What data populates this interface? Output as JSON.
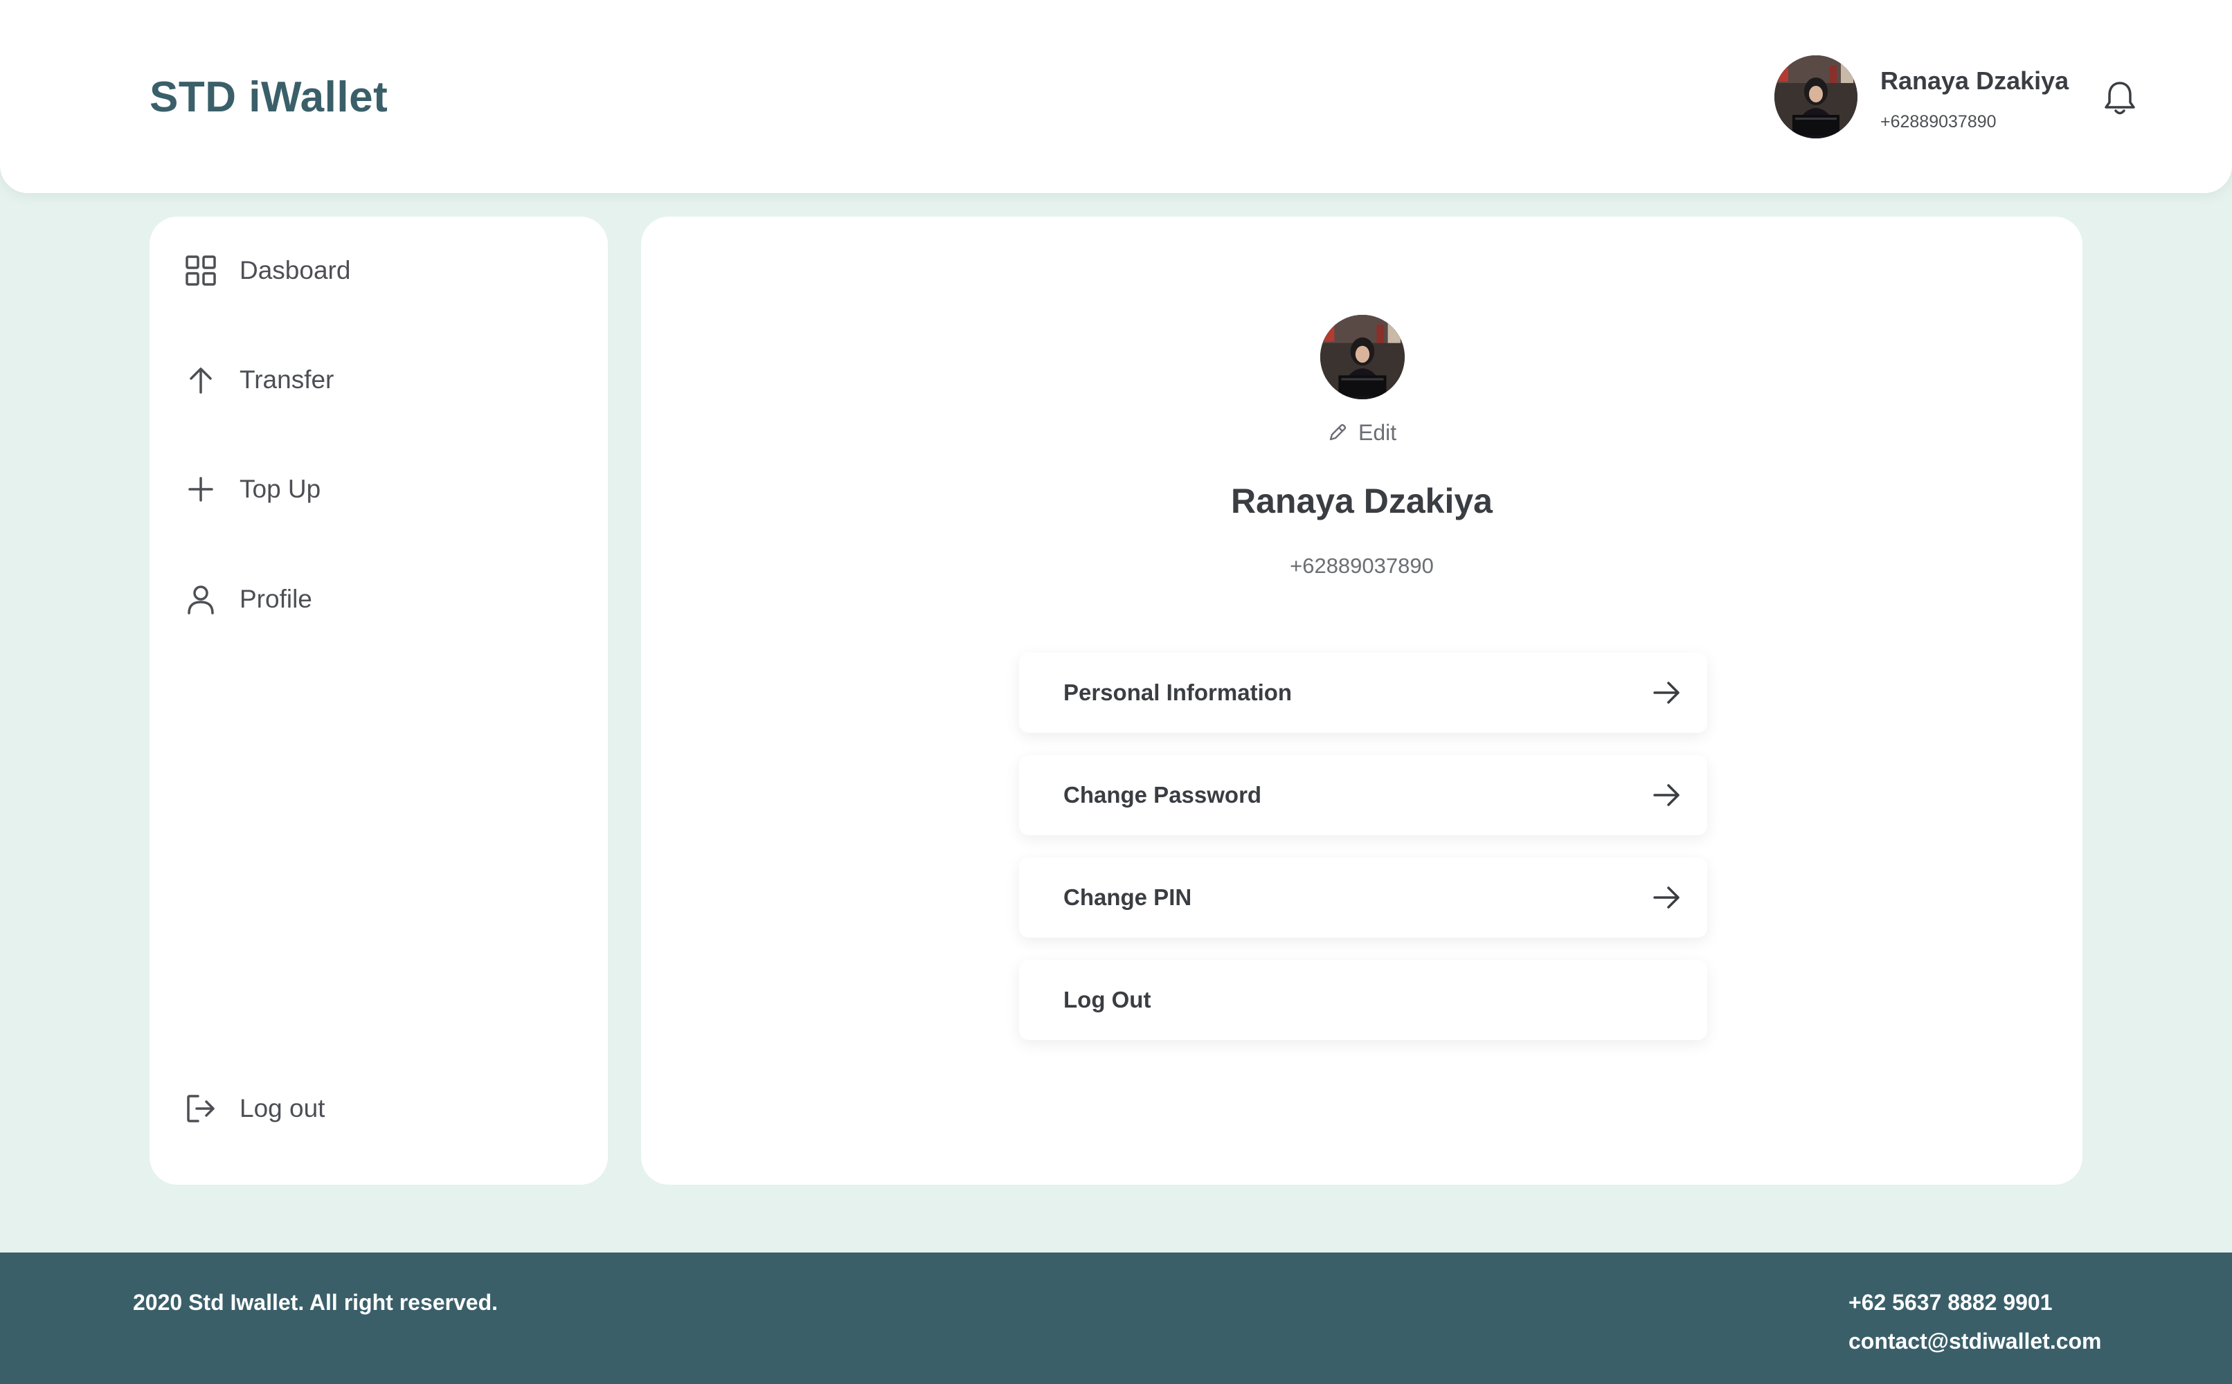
{
  "app": {
    "brand": "STD iWallet"
  },
  "header": {
    "user_name": "Ranaya Dzakiya",
    "user_phone": "+62889037890",
    "avatar_icon": "user-photo",
    "notification_icon": "bell-icon"
  },
  "sidebar": {
    "items": [
      {
        "label": "Dasboard",
        "icon": "grid-icon"
      },
      {
        "label": "Transfer",
        "icon": "arrow-up-icon"
      },
      {
        "label": "Top Up",
        "icon": "plus-icon"
      },
      {
        "label": "Profile",
        "icon": "user-icon"
      }
    ],
    "logout": {
      "label": "Log out",
      "icon": "logout-icon"
    }
  },
  "profile": {
    "edit_label": "Edit",
    "name": "Ranaya Dzakiya",
    "phone": "+62889037890",
    "menu": [
      {
        "label": "Personal Information",
        "has_arrow": true
      },
      {
        "label": "Change Password",
        "has_arrow": true
      },
      {
        "label": "Change PIN",
        "has_arrow": true
      },
      {
        "label": "Log Out",
        "has_arrow": false
      }
    ]
  },
  "footer": {
    "copyright": "2020 Std Iwallet. All right reserved.",
    "phone": "+62 5637 8882 9901",
    "email": "contact@stdiwallet.com"
  },
  "colors": {
    "background": "#e5f2ee",
    "brand": "#3a5f69",
    "card": "#ffffff",
    "text": "#3a3d42"
  }
}
